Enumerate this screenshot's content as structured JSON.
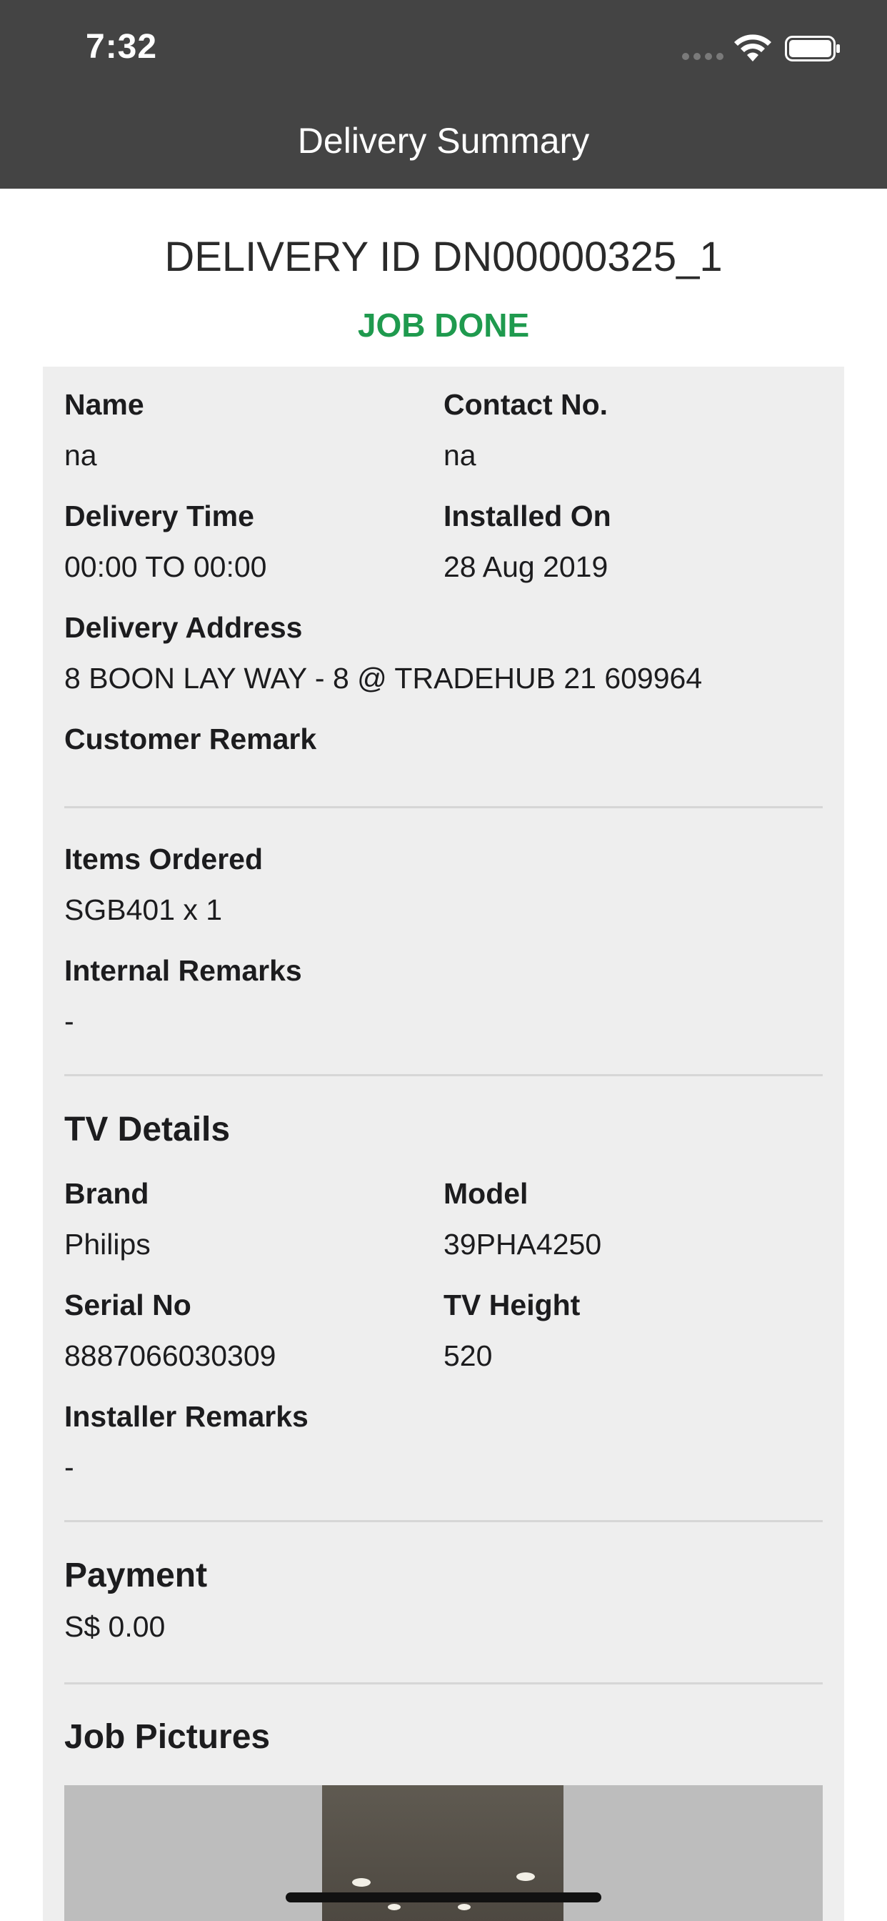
{
  "status_bar": {
    "time": "7:32"
  },
  "nav": {
    "title": "Delivery Summary"
  },
  "header": {
    "delivery_id": "DELIVERY ID DN00000325_1",
    "status": "JOB DONE",
    "status_color": "#1f9a4e"
  },
  "details": {
    "name_label": "Name",
    "name_value": "na",
    "contact_label": "Contact No.",
    "contact_value": "na",
    "delivery_time_label": "Delivery Time",
    "delivery_time_value": "00:00 TO 00:00",
    "installed_on_label": "Installed On",
    "installed_on_value": "28 Aug 2019",
    "address_label": "Delivery Address",
    "address_value": "8 BOON LAY WAY - 8 @ TRADEHUB 21 609964",
    "customer_remark_label": "Customer Remark",
    "customer_remark_value": ""
  },
  "order": {
    "items_label": "Items Ordered",
    "items_value": "SGB401 x 1",
    "internal_remarks_label": "Internal Remarks",
    "internal_remarks_value": "-"
  },
  "tv": {
    "title": "TV Details",
    "brand_label": "Brand",
    "brand_value": "Philips",
    "model_label": "Model",
    "model_value": "39PHA4250",
    "serial_label": "Serial No",
    "serial_value": "8887066030309",
    "height_label": "TV Height",
    "height_value": "520",
    "installer_remarks_label": "Installer Remarks",
    "installer_remarks_value": "-"
  },
  "payment": {
    "title": "Payment",
    "amount": "S$ 0.00"
  },
  "pictures": {
    "title": "Job Pictures"
  }
}
